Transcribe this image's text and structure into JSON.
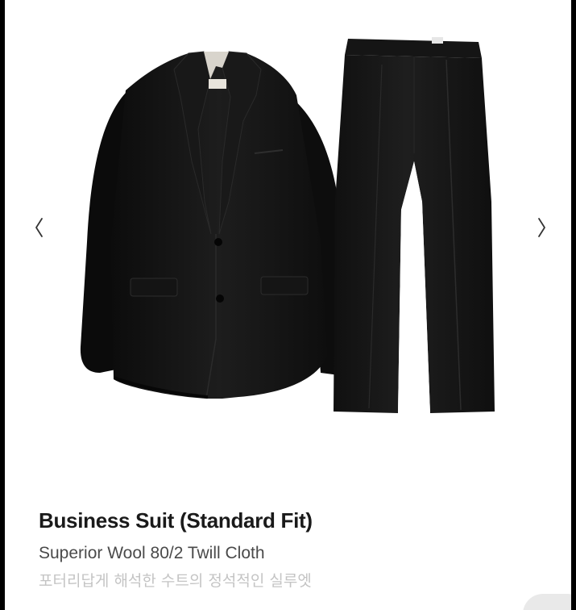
{
  "product": {
    "name": "Business Suit (Standard Fit)",
    "material": "Superior Wool 80/2 Twill Cloth",
    "description": "포터리답게 해석한 수트의 정석적인 실루엣"
  },
  "carousel": {
    "prev_icon": "chevron-left-icon",
    "next_icon": "chevron-right-icon",
    "image_subject": "black-suit-jacket-and-trousers"
  },
  "colors": {
    "background": "#ffffff",
    "suit": "#141414",
    "title": "#1a1a1a",
    "subtitle": "#4a4a4a",
    "description": "#c4c4c4"
  }
}
